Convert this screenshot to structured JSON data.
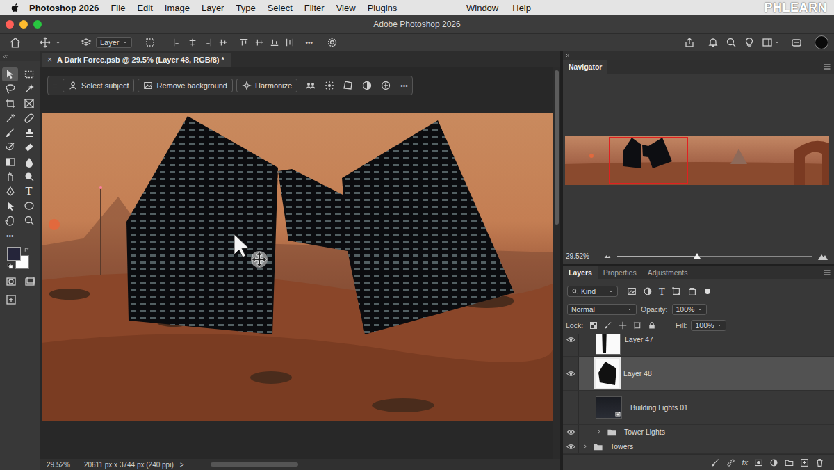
{
  "menubar": {
    "app": "Photoshop 2026",
    "items": [
      "File",
      "Edit",
      "Image",
      "Layer",
      "Type",
      "Select",
      "Filter",
      "View",
      "Plugins"
    ],
    "right_items": [
      "Window",
      "Help"
    ],
    "watermark": "PHLEARN"
  },
  "window": {
    "title": "Adobe Photoshop 2026"
  },
  "options_bar": {
    "target": "Layer",
    "more": "•••"
  },
  "toolbar": {
    "tools": [
      {
        "selected": true
      },
      {
        "selected": false
      },
      {
        "selected": false
      },
      {
        "selected": false
      },
      {
        "selected": false
      },
      {
        "selected": false
      },
      {
        "selected": false
      },
      {
        "selected": false
      },
      {
        "selected": false
      },
      {
        "selected": false
      },
      {
        "selected": false
      },
      {
        "selected": false
      },
      {
        "selected": false
      },
      {
        "selected": false
      },
      {
        "selected": false
      },
      {
        "selected": false
      },
      {
        "selected": false
      },
      {
        "selected": false,
        "label": "T"
      },
      {
        "selected": false
      },
      {
        "selected": false
      },
      {
        "selected": false
      },
      {
        "selected": false
      }
    ],
    "more": "•••",
    "foreground": "#25253a",
    "background": "#ffffff"
  },
  "document_tab": {
    "title": "A Dark Force.psb @ 29.5% (Layer 48, RGB/8) *",
    "close": "×"
  },
  "task_bar": {
    "buttons": [
      "Select subject",
      "Remove background",
      "Harmonize"
    ],
    "more": "•••"
  },
  "status_bar": {
    "zoom": "29.52%",
    "dimensions": "20611 px x 3744 px (240 ppi)",
    "arrow": ">"
  },
  "navigator": {
    "title": "Navigator",
    "zoom": "29.52%",
    "level": 0.41
  },
  "layers_panel": {
    "tabs": [
      {
        "label": "Layers",
        "selected": true
      },
      {
        "label": "Properties",
        "selected": false
      },
      {
        "label": "Adjustments",
        "selected": false
      }
    ],
    "filter": "Kind",
    "type_filter": "T",
    "blend_mode": "Normal",
    "opacity_label": "Opacity:",
    "opacity": "100%",
    "lock_label": "Lock:",
    "fill_label": "Fill:",
    "fill": "100%",
    "fx": "fx",
    "layers": [
      {
        "name": "Layer 47",
        "kind": "pixel",
        "visible": true,
        "selected": false,
        "nested": true
      },
      {
        "name": "Layer 48",
        "kind": "pixel",
        "visible": true,
        "selected": true,
        "nested": true
      },
      {
        "name": "Building Lights 01",
        "kind": "smart",
        "visible": false,
        "selected": false,
        "nested": true
      },
      {
        "name": "Tower Lights",
        "kind": "group",
        "visible": true,
        "selected": false,
        "nested": true,
        "expanded": false
      },
      {
        "name": "Towers",
        "kind": "group",
        "visible": true,
        "selected": false,
        "nested": false,
        "expanded": false
      }
    ]
  }
}
